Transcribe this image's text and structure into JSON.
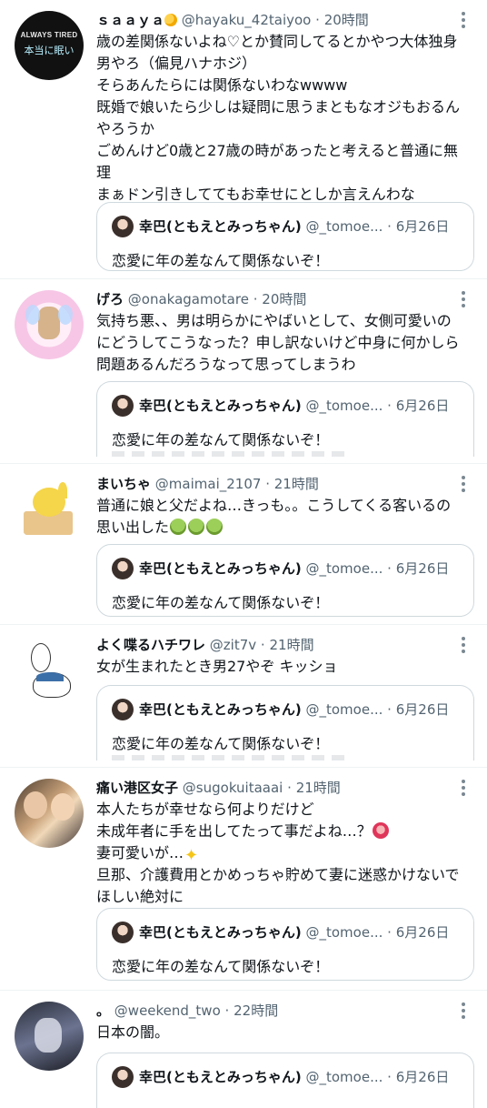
{
  "tweets": [
    {
      "name": "ｓａａｙａ",
      "handle": "@hayaku_42taiyoo",
      "time": "20時間",
      "avatar_text": "ALWAYS TIRED",
      "avatar_sub": "本当に眠い",
      "body": "歳の差関係ないよね♡とか賛同してるとかやつ大体独身\n男やろ（偏見ハナホジ）\nそらあんたらには関係ないわなwwww\n既婚で娘いたら少しは疑問に思うまともなオジもおるん\nやろうか\nごめんけど0歳と27歳の時があったと考えると普通に無\n理\nまぁドン引きしててもお幸せにとしか言えんわな"
    },
    {
      "name": "げろ",
      "handle": "@onakagamotare",
      "time": "20時間",
      "body": "気持ち悪、、男は明らかにやばいとして、女側可愛いの\nにどうしてこうなった？申し訳ないけど中身に何かしら\n問題あるんだろうなって思ってしまうわ"
    },
    {
      "name": "まいちゃ",
      "handle": "@maimai_2107",
      "time": "21時間",
      "body_line1": "普通に娘と父だよね…きっも。。こうしてくる客いるの",
      "body_line2": "思い出した"
    },
    {
      "name": "よく喋るハチワレ",
      "handle": "@zit7v",
      "time": "21時間",
      "body": "女が生まれたとき男27やぞ キッショ"
    },
    {
      "name": "痛い港区女子",
      "handle": "@sugokuitaaai",
      "time": "21時間",
      "body_line1": "本人たちが幸せなら何よりだけど",
      "body_line2": "未成年者に手を出してたって事だよね…？",
      "body_line3": "妻可愛いが…",
      "body_line4": "旦那、介護費用とかめっちゃ貯めて妻に迷惑かけないで\nほしい絶対に"
    },
    {
      "name": "。",
      "handle": "@weekend_two",
      "time": "22時間",
      "body": "日本の闇。"
    }
  ],
  "sep": "·",
  "quote": {
    "name": "幸巴(ともえとみっちゃん)",
    "handle": "@_tomoe...",
    "date": "6月26日",
    "text": "恋愛に年の差なんて関係ないぞ！"
  },
  "colors": {
    "text": "#0f1419",
    "secondary": "#536471",
    "border": "#cfd9de",
    "divider": "#eff3f4"
  }
}
